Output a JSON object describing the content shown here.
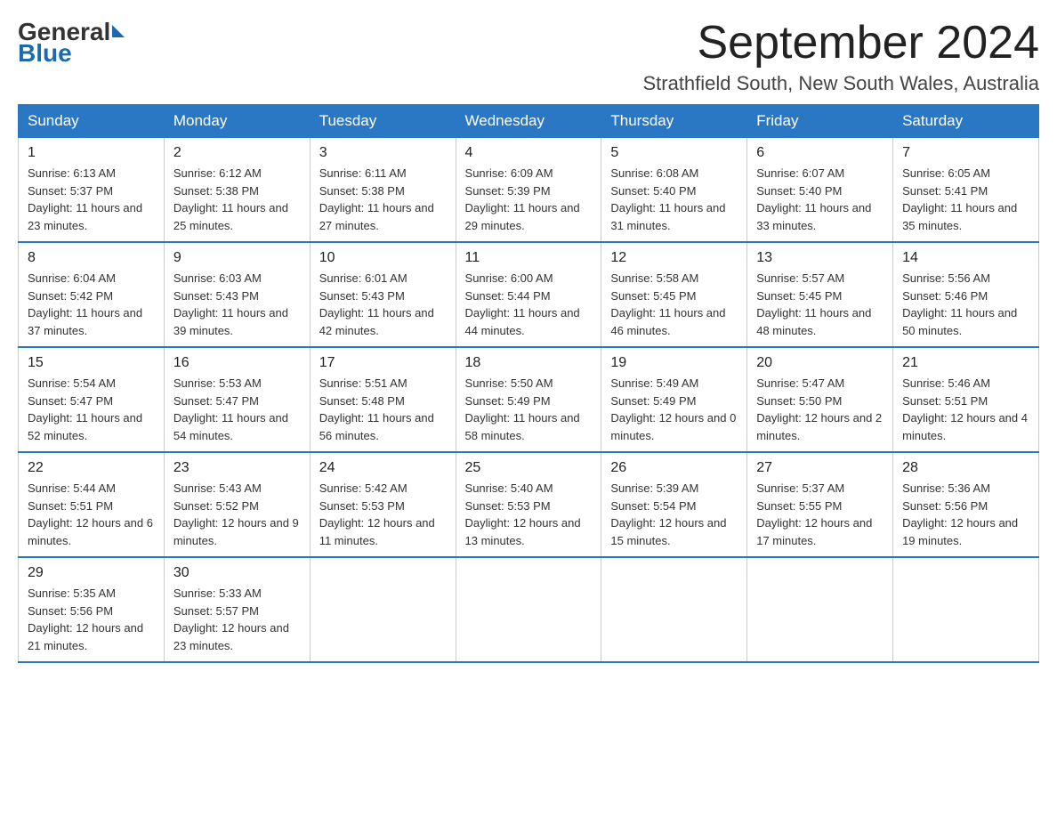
{
  "logo": {
    "general": "General",
    "triangle": "",
    "blue": "Blue"
  },
  "header": {
    "month_year": "September 2024",
    "location": "Strathfield South, New South Wales, Australia"
  },
  "days_of_week": [
    "Sunday",
    "Monday",
    "Tuesday",
    "Wednesday",
    "Thursday",
    "Friday",
    "Saturday"
  ],
  "weeks": [
    [
      {
        "day": "1",
        "sunrise": "6:13 AM",
        "sunset": "5:37 PM",
        "daylight": "11 hours and 23 minutes."
      },
      {
        "day": "2",
        "sunrise": "6:12 AM",
        "sunset": "5:38 PM",
        "daylight": "11 hours and 25 minutes."
      },
      {
        "day": "3",
        "sunrise": "6:11 AM",
        "sunset": "5:38 PM",
        "daylight": "11 hours and 27 minutes."
      },
      {
        "day": "4",
        "sunrise": "6:09 AM",
        "sunset": "5:39 PM",
        "daylight": "11 hours and 29 minutes."
      },
      {
        "day": "5",
        "sunrise": "6:08 AM",
        "sunset": "5:40 PM",
        "daylight": "11 hours and 31 minutes."
      },
      {
        "day": "6",
        "sunrise": "6:07 AM",
        "sunset": "5:40 PM",
        "daylight": "11 hours and 33 minutes."
      },
      {
        "day": "7",
        "sunrise": "6:05 AM",
        "sunset": "5:41 PM",
        "daylight": "11 hours and 35 minutes."
      }
    ],
    [
      {
        "day": "8",
        "sunrise": "6:04 AM",
        "sunset": "5:42 PM",
        "daylight": "11 hours and 37 minutes."
      },
      {
        "day": "9",
        "sunrise": "6:03 AM",
        "sunset": "5:43 PM",
        "daylight": "11 hours and 39 minutes."
      },
      {
        "day": "10",
        "sunrise": "6:01 AM",
        "sunset": "5:43 PM",
        "daylight": "11 hours and 42 minutes."
      },
      {
        "day": "11",
        "sunrise": "6:00 AM",
        "sunset": "5:44 PM",
        "daylight": "11 hours and 44 minutes."
      },
      {
        "day": "12",
        "sunrise": "5:58 AM",
        "sunset": "5:45 PM",
        "daylight": "11 hours and 46 minutes."
      },
      {
        "day": "13",
        "sunrise": "5:57 AM",
        "sunset": "5:45 PM",
        "daylight": "11 hours and 48 minutes."
      },
      {
        "day": "14",
        "sunrise": "5:56 AM",
        "sunset": "5:46 PM",
        "daylight": "11 hours and 50 minutes."
      }
    ],
    [
      {
        "day": "15",
        "sunrise": "5:54 AM",
        "sunset": "5:47 PM",
        "daylight": "11 hours and 52 minutes."
      },
      {
        "day": "16",
        "sunrise": "5:53 AM",
        "sunset": "5:47 PM",
        "daylight": "11 hours and 54 minutes."
      },
      {
        "day": "17",
        "sunrise": "5:51 AM",
        "sunset": "5:48 PM",
        "daylight": "11 hours and 56 minutes."
      },
      {
        "day": "18",
        "sunrise": "5:50 AM",
        "sunset": "5:49 PM",
        "daylight": "11 hours and 58 minutes."
      },
      {
        "day": "19",
        "sunrise": "5:49 AM",
        "sunset": "5:49 PM",
        "daylight": "12 hours and 0 minutes."
      },
      {
        "day": "20",
        "sunrise": "5:47 AM",
        "sunset": "5:50 PM",
        "daylight": "12 hours and 2 minutes."
      },
      {
        "day": "21",
        "sunrise": "5:46 AM",
        "sunset": "5:51 PM",
        "daylight": "12 hours and 4 minutes."
      }
    ],
    [
      {
        "day": "22",
        "sunrise": "5:44 AM",
        "sunset": "5:51 PM",
        "daylight": "12 hours and 6 minutes."
      },
      {
        "day": "23",
        "sunrise": "5:43 AM",
        "sunset": "5:52 PM",
        "daylight": "12 hours and 9 minutes."
      },
      {
        "day": "24",
        "sunrise": "5:42 AM",
        "sunset": "5:53 PM",
        "daylight": "12 hours and 11 minutes."
      },
      {
        "day": "25",
        "sunrise": "5:40 AM",
        "sunset": "5:53 PM",
        "daylight": "12 hours and 13 minutes."
      },
      {
        "day": "26",
        "sunrise": "5:39 AM",
        "sunset": "5:54 PM",
        "daylight": "12 hours and 15 minutes."
      },
      {
        "day": "27",
        "sunrise": "5:37 AM",
        "sunset": "5:55 PM",
        "daylight": "12 hours and 17 minutes."
      },
      {
        "day": "28",
        "sunrise": "5:36 AM",
        "sunset": "5:56 PM",
        "daylight": "12 hours and 19 minutes."
      }
    ],
    [
      {
        "day": "29",
        "sunrise": "5:35 AM",
        "sunset": "5:56 PM",
        "daylight": "12 hours and 21 minutes."
      },
      {
        "day": "30",
        "sunrise": "5:33 AM",
        "sunset": "5:57 PM",
        "daylight": "12 hours and 23 minutes."
      },
      null,
      null,
      null,
      null,
      null
    ]
  ],
  "labels": {
    "sunrise": "Sunrise:",
    "sunset": "Sunset:",
    "daylight": "Daylight:"
  }
}
